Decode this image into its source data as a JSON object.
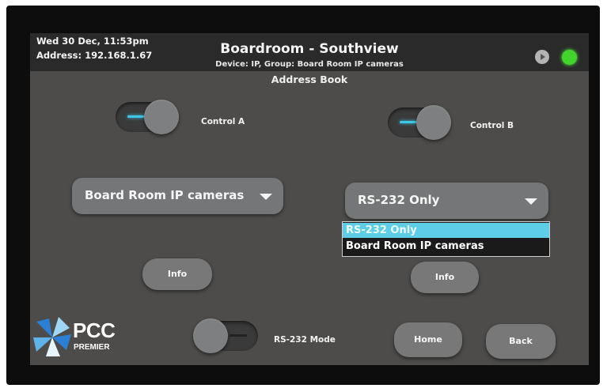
{
  "header": {
    "datetime": "Wed 30 Dec, 11:53pm",
    "address": "Address: 192.168.1.67",
    "title": "Boardroom - Southview",
    "subtitle": "Device: IP, Group: Board Room IP cameras",
    "play_icon": "play-icon",
    "status_color": "#43d32d"
  },
  "section_title": "Address Book",
  "control_a": {
    "label": "Control A",
    "state": "on",
    "accent": "#3fc6e6"
  },
  "control_b": {
    "label": "Control B",
    "state": "on",
    "accent": "#3fc6e6"
  },
  "dropdown_a": {
    "value": "Board Room IP cameras"
  },
  "dropdown_b": {
    "value": "RS-232 Only",
    "options": [
      "RS-232 Only",
      "Board Room IP cameras"
    ],
    "highlighted_option": "RS-232 Only"
  },
  "info_a_label": "Info",
  "info_b_label": "Info",
  "rs232_mode": {
    "label": "RS-232 Mode",
    "state": "off"
  },
  "home_label": "Home",
  "back_label": "Back",
  "logo": {
    "line1": "PCC",
    "line2": "PREMIER",
    "colors": [
      "#2b7fd4",
      "#9fd6f5",
      "#e8f4fb"
    ]
  }
}
